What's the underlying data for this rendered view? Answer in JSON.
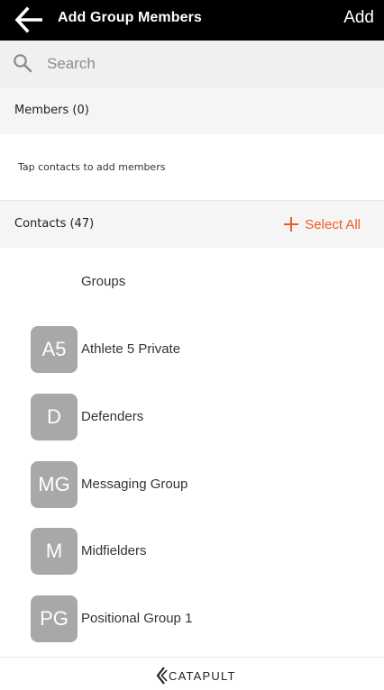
{
  "header": {
    "title": "Add Group Members",
    "add_label": "Add",
    "back_icon": "arrow-left-icon",
    "background": "#000000"
  },
  "search": {
    "placeholder": "Search",
    "value": "",
    "icon": "search-icon"
  },
  "members": {
    "title": "Members (0)",
    "hint": "Tap contacts to add members"
  },
  "contacts": {
    "title": "Contacts (47)",
    "select_all_label": "Select All",
    "select_all_icon": "plus-icon",
    "accent_color": "#f05a22",
    "groups_label": "Groups",
    "items": [
      {
        "initials": "A5",
        "name": "Athlete 5 Private"
      },
      {
        "initials": "D",
        "name": "Defenders"
      },
      {
        "initials": "MG",
        "name": "Messaging Group"
      },
      {
        "initials": "M",
        "name": "Midfielders"
      },
      {
        "initials": "PG",
        "name": "Positional Group 1"
      }
    ]
  },
  "footer": {
    "logo_text": "CATAPULT"
  }
}
